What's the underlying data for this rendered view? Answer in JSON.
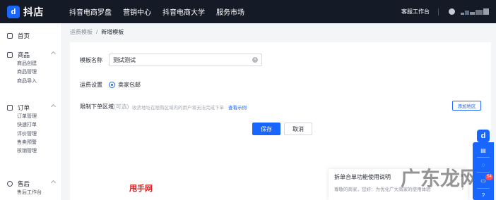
{
  "header": {
    "logo_mark": "d",
    "logo_text": "抖店",
    "nav": [
      "抖音电商罗盘",
      "营销中心",
      "抖音电商大学",
      "服务市场"
    ],
    "service_link": "客服工作台"
  },
  "sidebar": {
    "groups": [
      {
        "label": "首页",
        "icon": "home-icon",
        "items": []
      },
      {
        "label": "商品",
        "icon": "goods-icon",
        "items": [
          "商品创建",
          "商品管理",
          "商品导入"
        ]
      },
      {
        "label": "订单",
        "icon": "order-icon",
        "items": [
          "订单管理",
          "快速打单",
          "评价管理",
          "售卖预警",
          "核销管理"
        ]
      },
      {
        "label": "售后",
        "icon": "aftersale-icon",
        "items": [
          "售后工作台"
        ]
      }
    ]
  },
  "breadcrumb": {
    "parent": "运费模板",
    "separator": "/",
    "current": "新增模板"
  },
  "form": {
    "name_label": "模板名称",
    "name_value": "测试测试",
    "freight_label": "运费设置",
    "freight_option": "卖家包邮",
    "region_label": "限制下单区域",
    "region_optional": "(可选)",
    "region_hint": "收货地址在限购区域内的用户将无法完成下单",
    "region_link": "查看示例",
    "add_region_button": "添加地区",
    "save_button": "保存",
    "cancel_button": "取消"
  },
  "notice": {
    "title": "拆单合单功能使用说明",
    "body": "尊敬的商家，您好：为优化广大商家的使用体验"
  },
  "float_toolbar": {
    "badge": "54"
  },
  "watermarks": {
    "bottom": "甩手网",
    "site": "广东龙网"
  },
  "colors": {
    "accent": "#1966ff",
    "topbar": "#141b26",
    "badge": "#ff4d4f"
  }
}
